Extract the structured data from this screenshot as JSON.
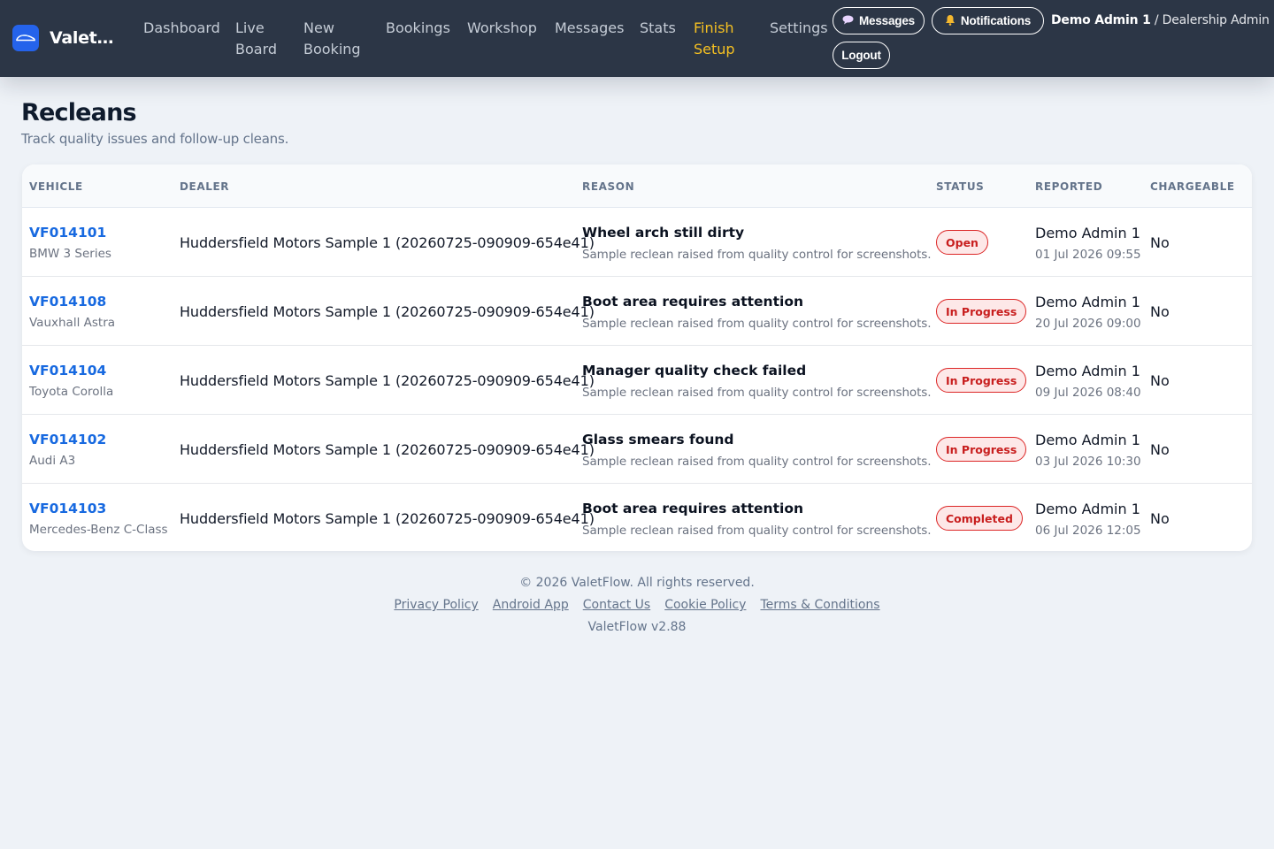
{
  "app": {
    "name": "ValetFlow",
    "brand_truncated": "ValetF...",
    "logo_icon": "car-icon",
    "accent_color": "#2563eb"
  },
  "nav": {
    "dashboard": [
      "Dashboard"
    ],
    "live_board": [
      "Live",
      "Board"
    ],
    "new_booking": [
      "New",
      "Booking"
    ],
    "bookings": [
      "Bookings"
    ],
    "workshop": [
      "Workshop"
    ],
    "messages": [
      "Messages"
    ],
    "stats": [
      "Stats"
    ],
    "finish_setup": [
      "Finish",
      "Setup"
    ],
    "settings": [
      "Settings"
    ]
  },
  "header_actions": {
    "messages_label": "Messages",
    "messages_icon": "speech-bubble-icon",
    "notifications_label": "Notifications",
    "notifications_icon": "bell-icon",
    "logout_label": "Logout"
  },
  "user": {
    "name": "Demo Admin 1",
    "separator": " / ",
    "role": "Dealership Admin"
  },
  "page": {
    "title": "Recleans",
    "subtitle": "Track quality issues and follow-up cleans."
  },
  "table": {
    "columns": [
      "VEHICLE",
      "DEALER",
      "REASON",
      "STATUS",
      "REPORTED",
      "CHARGEABLE"
    ],
    "rows": [
      {
        "vehicle_id": "VF014101",
        "vehicle_model": "BMW 3 Series",
        "dealer": "Huddersfield Motors Sample 1 (20260725-090909-654e41)",
        "reason": "Wheel arch still dirty",
        "reason_note": "Sample reclean raised from quality control for screenshots.",
        "status": "Open",
        "reported_by": "Demo Admin 1",
        "reported_at": "01 Jul 2026 09:55",
        "chargeable": "No"
      },
      {
        "vehicle_id": "VF014108",
        "vehicle_model": "Vauxhall Astra",
        "dealer": "Huddersfield Motors Sample 1 (20260725-090909-654e41)",
        "reason": "Boot area requires attention",
        "reason_note": "Sample reclean raised from quality control for screenshots.",
        "status": "In Progress",
        "reported_by": "Demo Admin 1",
        "reported_at": "20 Jul 2026 09:00",
        "chargeable": "No"
      },
      {
        "vehicle_id": "VF014104",
        "vehicle_model": "Toyota Corolla",
        "dealer": "Huddersfield Motors Sample 1 (20260725-090909-654e41)",
        "reason": "Manager quality check failed",
        "reason_note": "Sample reclean raised from quality control for screenshots.",
        "status": "In Progress",
        "reported_by": "Demo Admin 1",
        "reported_at": "09 Jul 2026 08:40",
        "chargeable": "No"
      },
      {
        "vehicle_id": "VF014102",
        "vehicle_model": "Audi A3",
        "dealer": "Huddersfield Motors Sample 1 (20260725-090909-654e41)",
        "reason": "Glass smears found",
        "reason_note": "Sample reclean raised from quality control for screenshots.",
        "status": "In Progress",
        "reported_by": "Demo Admin 1",
        "reported_at": "03 Jul 2026 10:30",
        "chargeable": "No"
      },
      {
        "vehicle_id": "VF014103",
        "vehicle_model": "Mercedes-Benz C-Class",
        "dealer": "Huddersfield Motors Sample 1 (20260725-090909-654e41)",
        "reason": "Boot area requires attention",
        "reason_note": "Sample reclean raised from quality control for screenshots.",
        "status": "Completed",
        "reported_by": "Demo Admin 1",
        "reported_at": "06 Jul 2026 12:05",
        "chargeable": "No"
      }
    ]
  },
  "colors": {
    "header_bg": "#2c3646",
    "nav_text": "#c5ccd6",
    "nav_accent": "#f5c022",
    "link": "#1769e0",
    "badge_border": "#dc2626",
    "badge_bg": "#fde8e8",
    "page_bg": "#eef2f7"
  },
  "footer": {
    "copyright": "© 2026 ValetFlow. All rights reserved.",
    "links": [
      "Privacy Policy",
      "Android App",
      "Contact Us",
      "Cookie Policy",
      "Terms & Conditions"
    ],
    "version": "ValetFlow v2.88"
  }
}
